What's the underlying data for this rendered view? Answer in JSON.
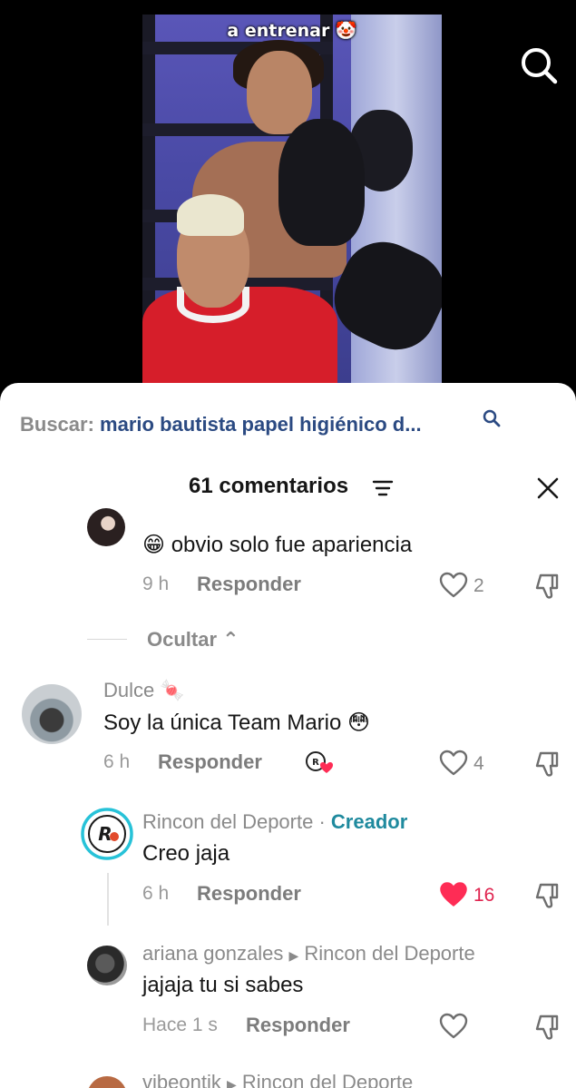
{
  "video": {
    "caption": "a entrenar 🤡",
    "search_icon": "search-icon"
  },
  "sheet": {
    "search_label": "Buscar:",
    "search_query": "mario bautista papel higiénico d...",
    "comment_count": "61 comentarios",
    "filter_icon": "filter-icon",
    "close_icon": "close-icon"
  },
  "comments": {
    "c1": {
      "text": "😁 obvio solo fue apariencia",
      "time": "9 h",
      "reply": "Responder",
      "likes": "2"
    },
    "hide": "Ocultar",
    "c2": {
      "username": "Dulce 🍬",
      "text": "Soy la única Team Mario 😳",
      "time": "6 h",
      "reply": "Responder",
      "likes": "4"
    },
    "c3": {
      "username": "Rincon del Deporte",
      "separator": "·",
      "badge": "Creador",
      "text": "Creo jaja",
      "time": "6 h",
      "reply": "Responder",
      "likes": "16",
      "like_color": "#fe2c55"
    },
    "c4": {
      "username": "ariana gonzales",
      "reply_to": "Rincon del Deporte",
      "text": "jajaja tu si sabes",
      "time": "Hace 1 s",
      "reply": "Responder"
    },
    "c5": {
      "username": "vibeontik",
      "reply_to": "Rincon del Deporte"
    }
  }
}
